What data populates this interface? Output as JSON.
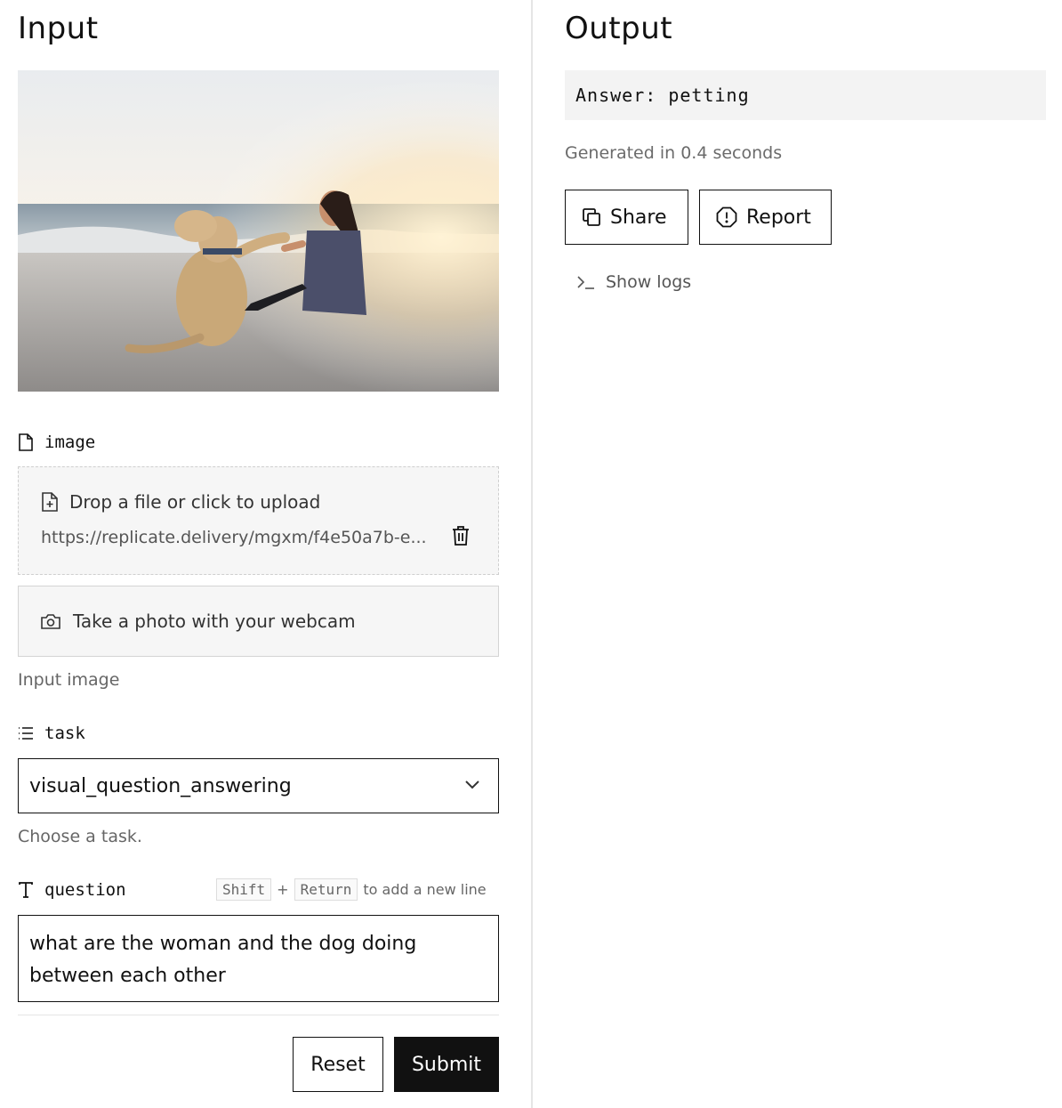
{
  "input": {
    "title": "Input",
    "image_field": {
      "label": "image",
      "upload_text": "Drop a file or click to upload",
      "url": "https://replicate.delivery/mgxm/f4e50a7b-e...",
      "webcam_text": "Take a photo with your webcam",
      "hint": "Input image"
    },
    "task_field": {
      "label": "task",
      "value": "visual_question_answering",
      "hint": "Choose a task."
    },
    "question_field": {
      "label": "question",
      "key_shift": "Shift",
      "plus": "+",
      "key_return": "Return",
      "newline_hint": "to add a new line",
      "value": "what are the woman and the dog doing between each other"
    },
    "reset_label": "Reset",
    "submit_label": "Submit"
  },
  "output": {
    "title": "Output",
    "answer": "Answer: petting",
    "generated": "Generated in 0.4 seconds",
    "share_label": "Share",
    "report_label": "Report",
    "logs_label": "Show logs"
  }
}
